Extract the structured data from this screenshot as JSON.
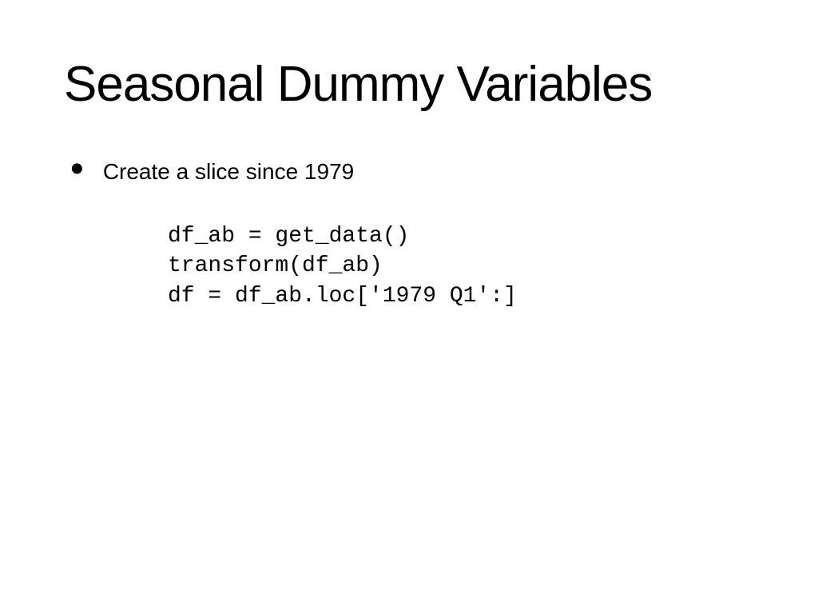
{
  "slide": {
    "title": "Seasonal Dummy Variables",
    "bullet_text": "Create a slice since 1979",
    "code_line_1": "df_ab = get_data()",
    "code_line_2": "transform(df_ab)",
    "code_line_3": "df = df_ab.loc['1979 Q1':]"
  }
}
